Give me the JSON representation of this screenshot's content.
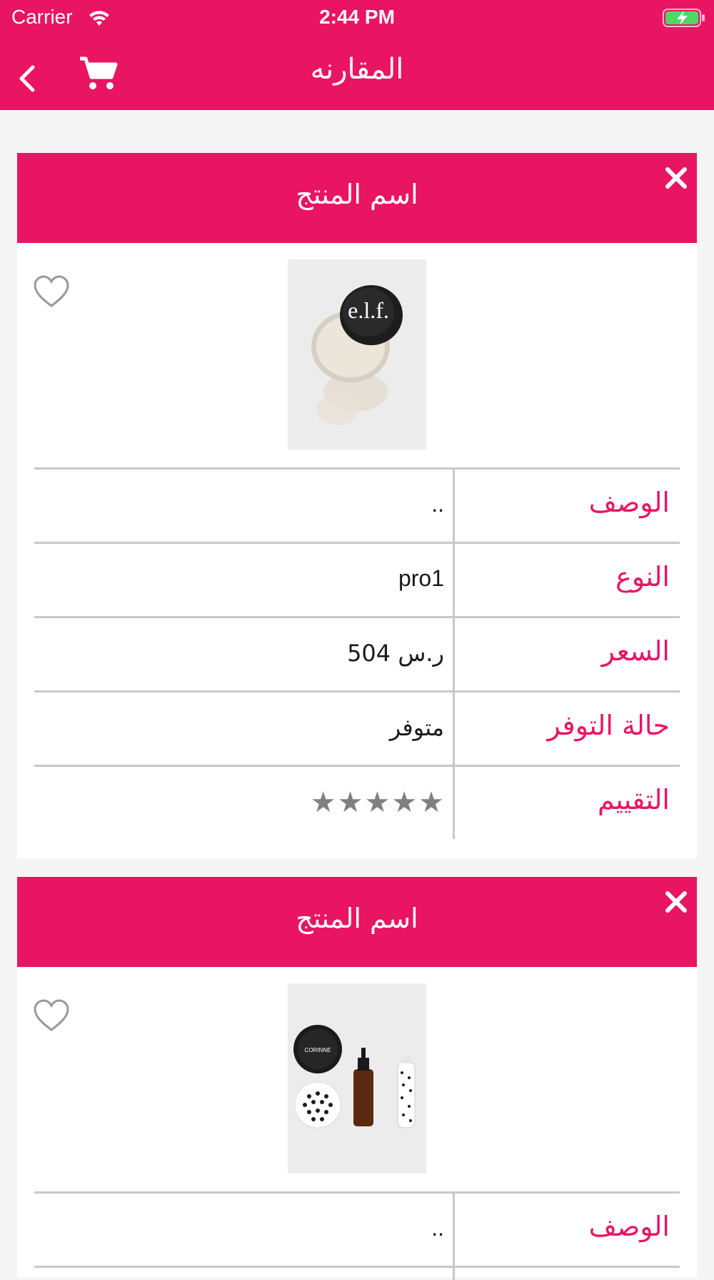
{
  "status": {
    "carrier": "Carrier",
    "time": "2:44 PM"
  },
  "nav": {
    "title": "المقارنه"
  },
  "colors": {
    "accent": "#e91462",
    "star": "#808080"
  },
  "products": [
    {
      "header_name": "اسم المنتج",
      "image_desc": "elf-loose-powder-jar",
      "attributes": {
        "description_label": "الوصف",
        "description_value": "..",
        "type_label": "النوع",
        "type_value": "pro1",
        "price_label": "السعر",
        "price_value": "ر.س 504",
        "availability_label": "حالة التوفر",
        "availability_value": "متوفر",
        "rating_label": "التقييم"
      },
      "rating": 5
    },
    {
      "header_name": "اسم المنتج",
      "image_desc": "corinne-cosmetics-set",
      "attributes": {
        "description_label": "الوصف",
        "description_value": ".."
      }
    }
  ]
}
